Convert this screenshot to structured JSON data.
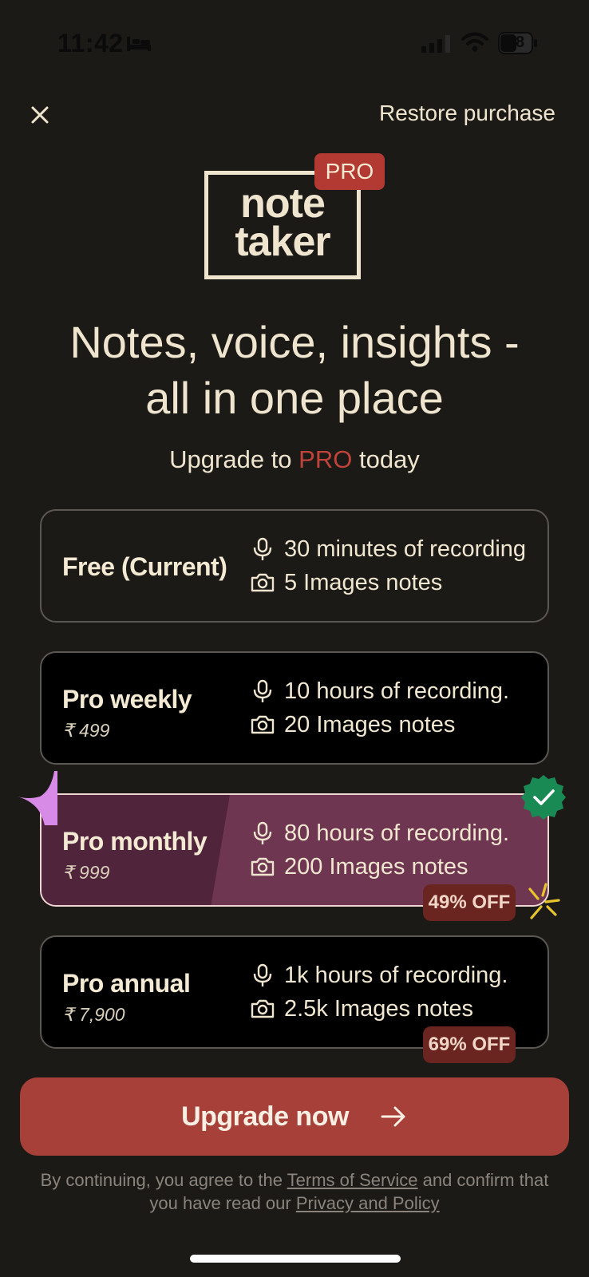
{
  "status_bar": {
    "time": "11:42",
    "battery": "48",
    "icons": [
      "bed-icon",
      "signal-icon",
      "wifi-icon",
      "battery-icon"
    ]
  },
  "header": {
    "close_icon": "close-icon",
    "restore_label": "Restore purchase"
  },
  "logo": {
    "line1": "note",
    "line2": "taker",
    "badge": "PRO"
  },
  "hero": {
    "headline_line1": "Notes, voice, insights -",
    "headline_line2": "all in one place",
    "sub_prefix": "Upgrade to ",
    "sub_highlight": "PRO",
    "sub_suffix": " today"
  },
  "plans": [
    {
      "name": "Free (Current)",
      "price": "",
      "feature1": "30 minutes of recording",
      "feature2": "5 Images notes",
      "selected": false
    },
    {
      "name": "Pro weekly",
      "price": "₹ 499",
      "feature1": "10 hours of recording.",
      "feature2": "20 Images notes",
      "selected": false
    },
    {
      "name": "Pro monthly",
      "price": "₹ 999",
      "feature1": "80 hours of recording.",
      "feature2": "200 Images notes",
      "discount": "49% OFF",
      "selected": true
    },
    {
      "name": "Pro annual",
      "price": "₹ 7,900",
      "feature1": "1k hours of recording.",
      "feature2": "2.5k Images notes",
      "discount": "69% OFF",
      "selected": false
    }
  ],
  "feature_icons": [
    "microphone-icon",
    "camera-icon"
  ],
  "cta": {
    "label": "Upgrade now"
  },
  "legal": {
    "prefix": "By continuing, you agree to the ",
    "terms": "Terms of Service",
    "middle": " and confirm that you have read our ",
    "privacy": "Privacy and Policy"
  },
  "colors": {
    "background": "#1c1a17",
    "accent": "#a8403a",
    "pro_red": "#b23a33",
    "selected_card": "#6e3650",
    "check_green": "#1a8a55",
    "cream_text": "#efe5cf"
  }
}
